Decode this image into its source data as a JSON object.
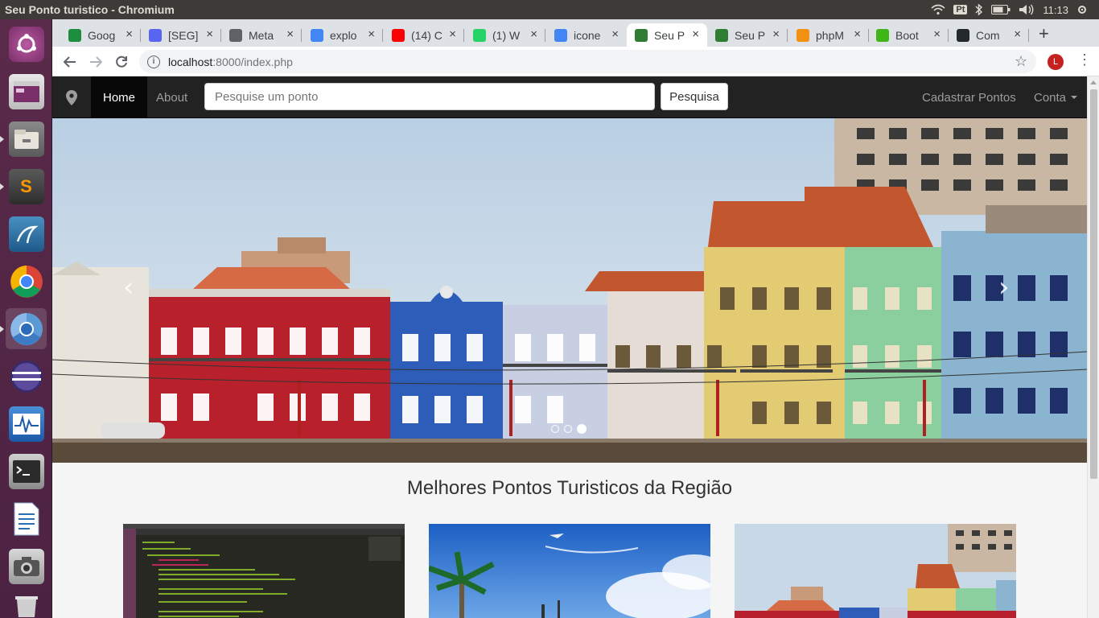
{
  "os": {
    "window_title": "Seu Ponto turistico - Chromium",
    "keyboard_layout": "Pt",
    "clock": "11:13",
    "launcher": [
      "ubuntu-dash",
      "workspace-switcher",
      "files",
      "sublime-text",
      "mysql-workbench",
      "google-chrome",
      "chromium",
      "eclipse",
      "system-monitor",
      "terminal",
      "libreoffice-writer",
      "screenshot",
      "trash"
    ]
  },
  "browser": {
    "tabs": [
      {
        "label": "Goog",
        "favicon_color": "#1e8e3e",
        "active": false
      },
      {
        "label": "[SEG]",
        "favicon_color": "#5865f2",
        "active": false
      },
      {
        "label": "Meta",
        "favicon_color": "#5f6368",
        "active": false
      },
      {
        "label": "explo",
        "favicon_color": "#4285f4",
        "active": false
      },
      {
        "label": "(14) C",
        "favicon_color": "#ff0000",
        "active": false
      },
      {
        "label": "(1) W",
        "favicon_color": "#25d366",
        "active": false
      },
      {
        "label": "icone",
        "favicon_color": "#4285f4",
        "active": false
      },
      {
        "label": "Seu P",
        "favicon_color": "#2e7d32",
        "active": true
      },
      {
        "label": "Seu P",
        "favicon_color": "#2e7d32",
        "active": false
      },
      {
        "label": "phpM",
        "favicon_color": "#f29111",
        "active": false
      },
      {
        "label": "Boot",
        "favicon_color": "#3fb618",
        "active": false
      },
      {
        "label": "Com",
        "favicon_color": "#24292e",
        "active": false
      }
    ],
    "url_host": "localhost",
    "url_path": ":8000/index.php",
    "profile_initial": "L"
  },
  "page": {
    "nav": {
      "home": "Home",
      "about": "About",
      "search_placeholder": "Pesquise um ponto",
      "search_button": "Pesquisa",
      "register": "Cadastrar Pontos",
      "account": "Conta"
    },
    "carousel": {
      "prev": "‹",
      "next": "›",
      "slide_count": 3,
      "active_index": 2
    },
    "section_title": "Melhores Pontos Turisticos da Região"
  }
}
